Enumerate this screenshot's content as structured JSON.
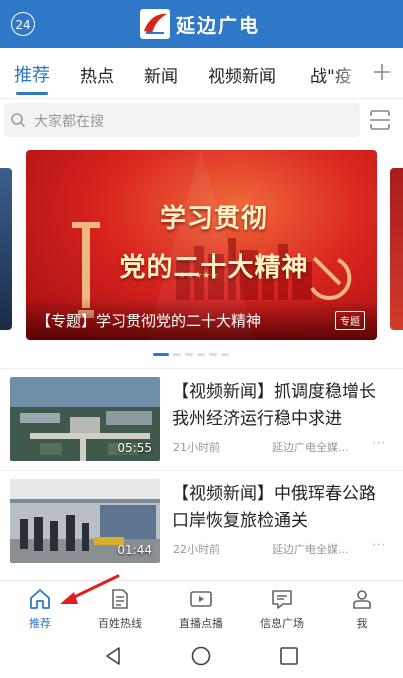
{
  "header": {
    "badge": "24",
    "app_title": "延边广电",
    "brand_color": "#2f78c8"
  },
  "tabs": [
    {
      "label": "推荐",
      "active": true
    },
    {
      "label": "热点"
    },
    {
      "label": "新闻"
    },
    {
      "label": "视频新闻"
    },
    {
      "label": "战\"疫"
    }
  ],
  "search": {
    "placeholder": "大家都在搜"
  },
  "carousel": {
    "headline_line1": "学习贯彻",
    "headline_line2": "党的二十大精神",
    "caption": "【专题】学习贯彻党的二十大精神",
    "tag": "专题",
    "active_dot": 0,
    "dot_count": 6
  },
  "news": [
    {
      "title": "【视频新闻】抓调度稳增长 我州经济运行稳中求进",
      "duration": "05:55",
      "time": "21小时前",
      "source": "延边广电全媒..."
    },
    {
      "title": "【视频新闻】中俄珲春公路口岸恢复旅检通关",
      "duration": "01:44",
      "time": "22小时前",
      "source": "延边广电全媒..."
    }
  ],
  "bottom_nav": [
    {
      "label": "推荐",
      "icon": "home-icon",
      "active": true
    },
    {
      "label": "百姓热线",
      "icon": "document-icon"
    },
    {
      "label": "直播点播",
      "icon": "play-icon"
    },
    {
      "label": "信息广场",
      "icon": "message-icon"
    },
    {
      "label": "我",
      "icon": "person-icon"
    }
  ]
}
